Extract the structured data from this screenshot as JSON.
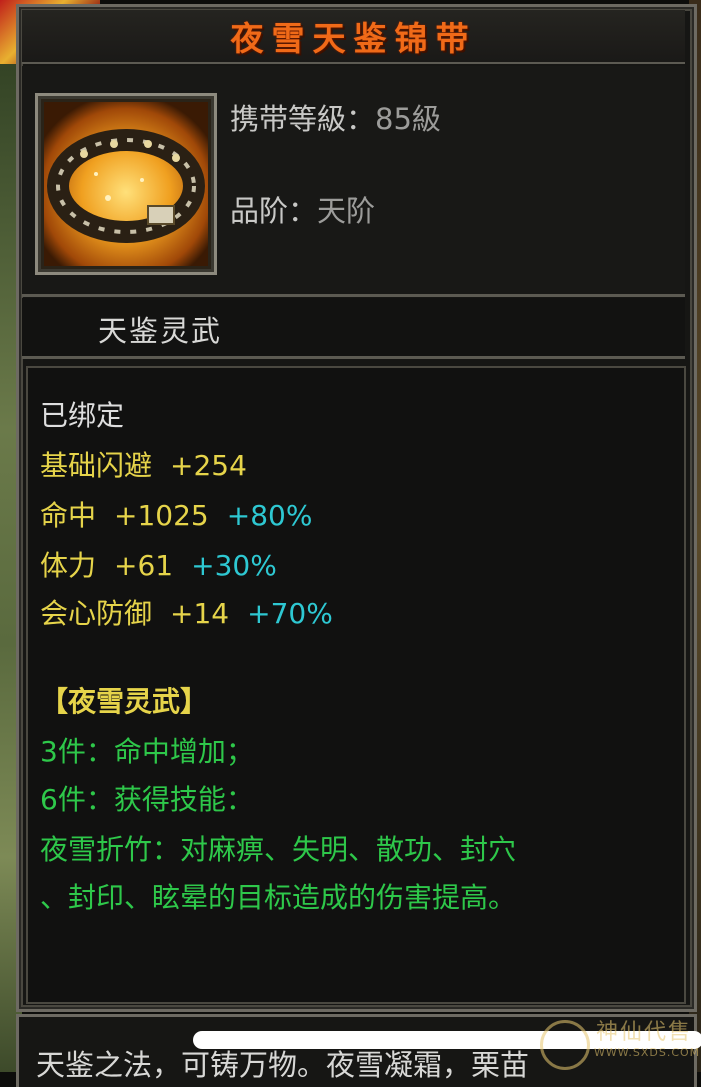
{
  "item": {
    "name": "夜雪天鉴锦带",
    "carry_level_label": "携带等級：",
    "carry_level_value": "85級",
    "grade_label": "品阶：",
    "grade_value": "天阶",
    "subtitle": "天鉴灵武",
    "icon": "belt-icon"
  },
  "stats": {
    "bound": "已绑定",
    "lines": [
      {
        "name": "基础闪避",
        "value": "+254",
        "bonus": ""
      },
      {
        "name": "命中",
        "value": "+1025",
        "bonus": "+80%"
      },
      {
        "name": "体力",
        "value": "+61",
        "bonus": "+30%"
      },
      {
        "name": "会心防御",
        "value": "+14",
        "bonus": "+70%"
      }
    ]
  },
  "set_bonus": {
    "title": "【夜雪灵武】",
    "lines": [
      "3件：命中增加；",
      "6件：获得技能：",
      "夜雪折竹：对麻痹、失明、散功、封穴",
      "、封印、眩晕的目标造成的伤害提高。"
    ]
  },
  "bottom_text": "天鉴之法，可铸万物。夜雪凝霜，栗苗",
  "watermark": {
    "text": "神仙代售",
    "url": "WWW.SXDS.COM"
  },
  "colors": {
    "title": "#f06a18",
    "stat_name": "#e6d44a",
    "bonus": "#2ec8d2",
    "set": "#2ec84a"
  }
}
